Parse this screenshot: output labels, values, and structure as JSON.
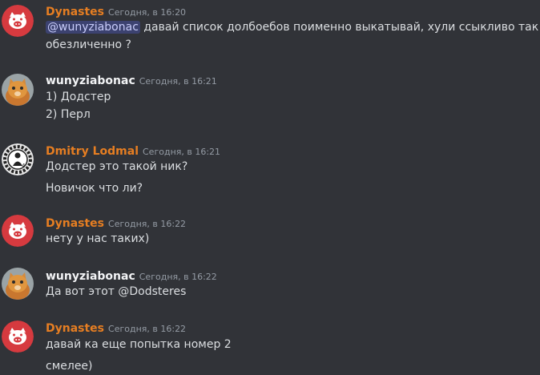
{
  "messages": [
    {
      "author": "Dynastes",
      "author_color": "#e67e22",
      "avatar": "pig-logo-icon",
      "time": "Сегодня, в 16:20",
      "mention": "@wunyziabonac",
      "text": " давай список долбоебов поименно выкатывай, хули ссыкливо так",
      "text2": "обезличенно ?"
    },
    {
      "author": "wunyziabonac",
      "author_color": "#f2f3f5",
      "avatar": "cat-photo-icon",
      "time": "Сегодня, в 16:21",
      "lines": [
        "1) Додстер",
        "2) Перл"
      ]
    },
    {
      "author": "Dmitry Lodmal",
      "author_color": "#e67e22",
      "avatar": "gear-emblem-icon",
      "time": "Сегодня, в 16:21",
      "lines": [
        "Додстер это такой ник?",
        "Новичок что ли?"
      ]
    },
    {
      "author": "Dynastes",
      "author_color": "#e67e22",
      "avatar": "pig-logo-icon",
      "time": "Сегодня, в 16:22",
      "lines": [
        "нету у нас таких)"
      ]
    },
    {
      "author": "wunyziabonac",
      "author_color": "#f2f3f5",
      "avatar": "cat-photo-icon",
      "time": "Сегодня, в 16:22",
      "lines": [
        "Да вот этот @Dodsteres"
      ]
    },
    {
      "author": "Dynastes",
      "author_color": "#e67e22",
      "avatar": "pig-logo-icon",
      "time": "Сегодня, в 16:22",
      "lines": [
        "давай ка еще попытка номер 2",
        "смелее)"
      ]
    }
  ]
}
